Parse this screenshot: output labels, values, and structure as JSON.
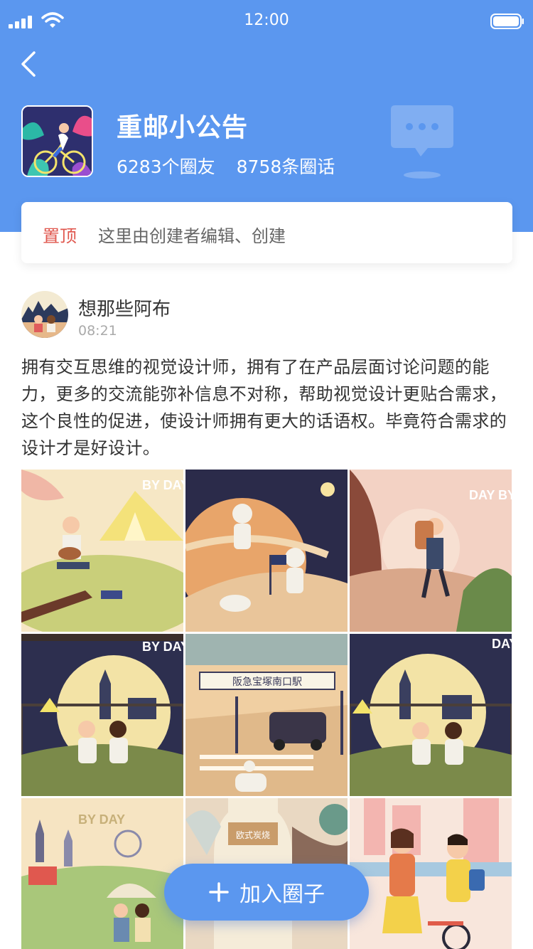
{
  "status_bar": {
    "time": "12:00",
    "signal_icon": "signal-icon",
    "wifi_icon": "wifi-icon",
    "battery_icon": "battery-icon"
  },
  "header": {
    "back_icon": "chevron-left-icon",
    "circle_name": "重邮小公告",
    "members": "6283个圈友",
    "posts": "8758条圈话",
    "deco_icon": "chat-bubble-icon"
  },
  "pinned": {
    "tag": "置顶",
    "text": "这里由创建者编辑、创建"
  },
  "post": {
    "author": "想那些阿布",
    "time": "08:21",
    "body": "拥有交互思维的视觉设计师，拥有了在产品层面讨论问题的能力，更多的交流能弥补信息不对称，帮助视觉设计更贴合需求，这个良性的促进，使设计师拥有更大的话语权。毕竟符合需求的设计才是好设计。",
    "photos": [
      {
        "caption": "BY DAY"
      },
      {
        "caption": ""
      },
      {
        "caption": "DAY BY DAY"
      },
      {
        "caption": "BY DAY"
      },
      {
        "caption": "阪急宝塚南口駅"
      },
      {
        "caption": "DAY BY DAY"
      },
      {
        "caption": "BY DAY"
      },
      {
        "caption": "欧式炭烧"
      },
      {
        "caption": ""
      }
    ]
  },
  "join_button": {
    "label": "加入圈子",
    "icon": "plus-icon"
  },
  "colors": {
    "primary": "#5b97ef",
    "pinned_tag": "#e0584f"
  }
}
